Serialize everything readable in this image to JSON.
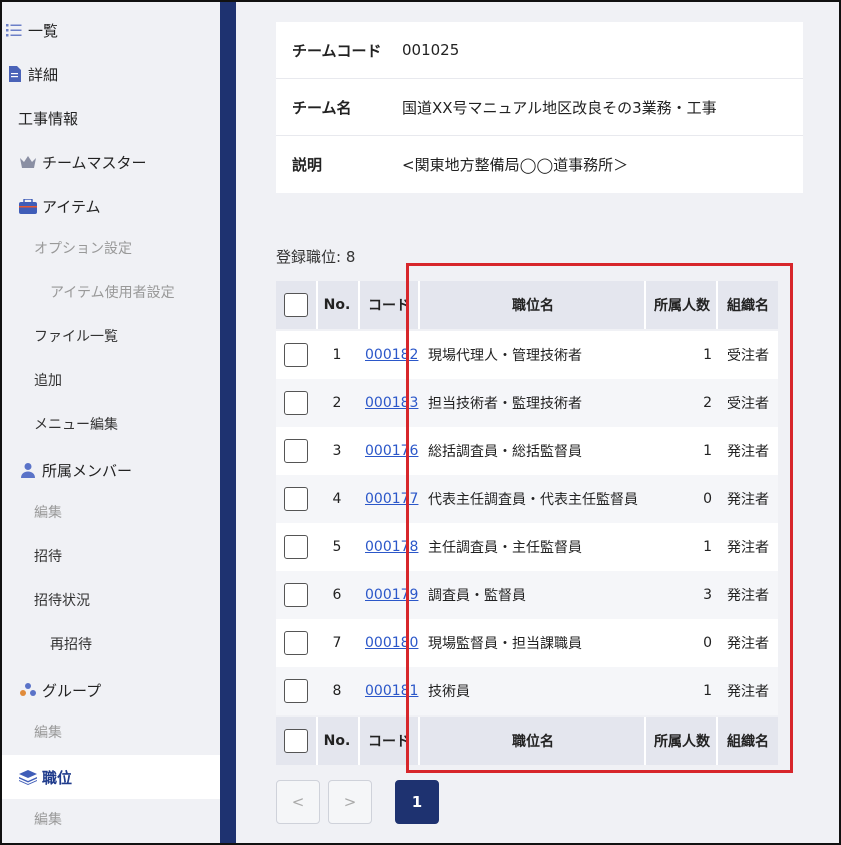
{
  "sidebar": {
    "items": [
      {
        "label": "一覧",
        "icon": "list-icon"
      },
      {
        "label": "詳細",
        "icon": "document-icon"
      },
      {
        "label": "工事情報"
      },
      {
        "label": "チームマスター",
        "icon": "crown-icon"
      },
      {
        "label": "アイテム",
        "icon": "toolbox-icon"
      },
      {
        "label": "オプション設定"
      },
      {
        "label": "アイテム使用者設定"
      },
      {
        "label": "ファイル一覧"
      },
      {
        "label": "追加"
      },
      {
        "label": "メニュー編集"
      },
      {
        "label": "所属メンバー",
        "icon": "person-icon"
      },
      {
        "label": "編集"
      },
      {
        "label": "招待"
      },
      {
        "label": "招待状況"
      },
      {
        "label": "再招待"
      },
      {
        "label": "グループ",
        "icon": "group-icon"
      },
      {
        "label": "編集"
      },
      {
        "label": "職位",
        "icon": "layers-icon"
      },
      {
        "label": "編集"
      }
    ]
  },
  "info": {
    "rows": [
      {
        "label": "チームコード",
        "value": "001025"
      },
      {
        "label": "チーム名",
        "value": "国道XX号マニュアル地区改良その3業務・工事"
      },
      {
        "label": "説明",
        "value": "<関東地方整備局◯◯道事務所＞"
      }
    ]
  },
  "table": {
    "count_text": "登録職位: 8",
    "headers": {
      "no": "No.",
      "code": "コード",
      "name": "職位名",
      "count": "所属人数",
      "org": "組織名"
    },
    "rows": [
      {
        "no": "1",
        "code": "000182",
        "name": "現場代理人・管理技術者",
        "count": "1",
        "org": "受注者"
      },
      {
        "no": "2",
        "code": "000183",
        "name": "担当技術者・監理技術者",
        "count": "2",
        "org": "受注者"
      },
      {
        "no": "3",
        "code": "000176",
        "name": "総括調査員・総括監督員",
        "count": "1",
        "org": "発注者"
      },
      {
        "no": "4",
        "code": "000177",
        "name": "代表主任調査員・代表主任監督員",
        "count": "0",
        "org": "発注者"
      },
      {
        "no": "5",
        "code": "000178",
        "name": "主任調査員・主任監督員",
        "count": "1",
        "org": "発注者"
      },
      {
        "no": "6",
        "code": "000179",
        "name": "調査員・監督員",
        "count": "3",
        "org": "発注者"
      },
      {
        "no": "7",
        "code": "000180",
        "name": "現場監督員・担当課職員",
        "count": "0",
        "org": "発注者"
      },
      {
        "no": "8",
        "code": "000181",
        "name": "技術員",
        "count": "1",
        "org": "発注者"
      }
    ]
  },
  "pagination": {
    "prev": "<",
    "next": ">",
    "current": "1"
  },
  "colors": {
    "nav_dark": "#1e3270",
    "link": "#2b57c9",
    "highlight_border": "#d7262b"
  }
}
